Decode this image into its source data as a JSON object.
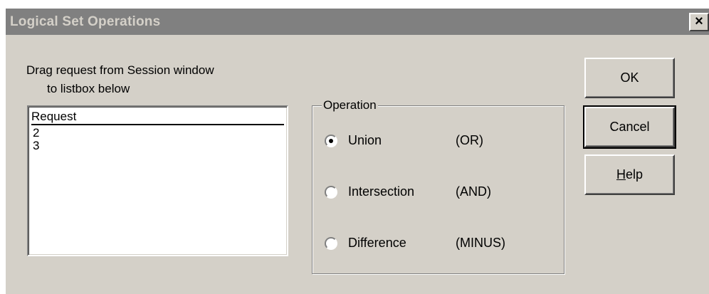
{
  "window": {
    "title": "Logical Set Operations",
    "close_label": "×"
  },
  "instructions": {
    "line1": "Drag request from Session window",
    "line2": "to listbox below"
  },
  "listbox": {
    "header": "Request",
    "items": [
      "2",
      "3"
    ]
  },
  "operation": {
    "group_label": "Operation",
    "options": [
      {
        "label": "Union",
        "code": "(OR)",
        "selected": true
      },
      {
        "label": "Intersection",
        "code": "(AND)",
        "selected": false
      },
      {
        "label": "Difference",
        "code": "(MINUS)",
        "selected": false
      }
    ]
  },
  "buttons": {
    "ok": "OK",
    "cancel": "Cancel",
    "help_mnemonic": "H",
    "help_rest": "elp"
  },
  "colors": {
    "face": "#d4d0c8",
    "titlebar_inactive": "#808080"
  }
}
